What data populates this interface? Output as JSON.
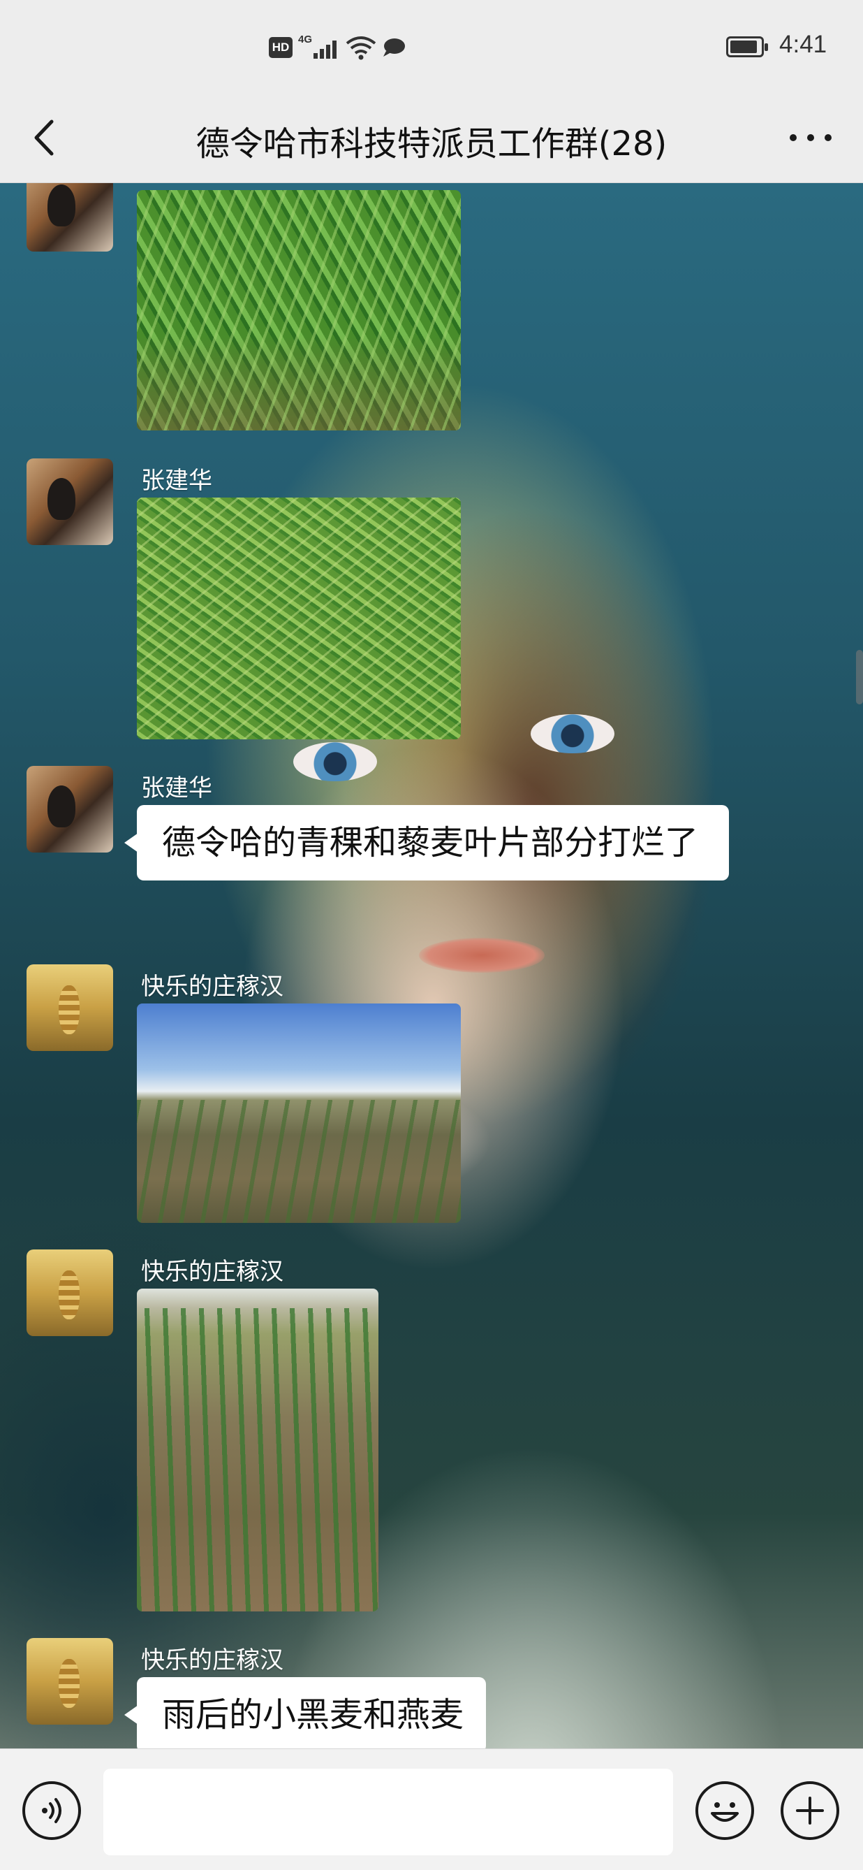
{
  "status_bar": {
    "hd_label": "HD",
    "network_label": "4G",
    "time": "4:41"
  },
  "header": {
    "title": "德令哈市科技特派员工作群(28)",
    "back_icon": "chevron-left-icon",
    "more_icon": "more-horizontal-icon"
  },
  "messages": [
    {
      "sender": "",
      "type": "image",
      "content": ""
    },
    {
      "sender": "张建华",
      "type": "image",
      "content": ""
    },
    {
      "sender": "张建华",
      "type": "text",
      "content": "德令哈的青稞和藜麦叶片部分打烂了"
    },
    {
      "sender": "快乐的庄稼汉",
      "type": "image",
      "content": ""
    },
    {
      "sender": "快乐的庄稼汉",
      "type": "image",
      "content": ""
    },
    {
      "sender": "快乐的庄稼汉",
      "type": "text",
      "content": "雨后的小黑麦和燕麦"
    }
  ],
  "input_bar": {
    "value": "",
    "voice_icon": "voice-icon",
    "emoji_icon": "emoji-icon",
    "plus_icon": "plus-icon"
  },
  "colors": {
    "header_bg": "#ededed",
    "bubble_bg": "#ffffff",
    "nickname": "#ffffff"
  }
}
